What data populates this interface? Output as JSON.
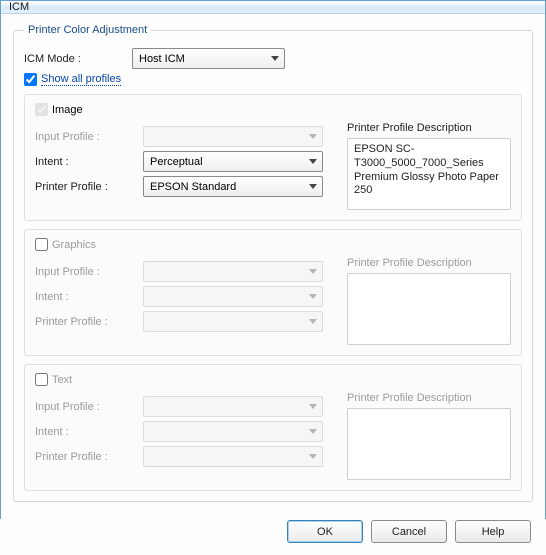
{
  "window": {
    "title": "ICM"
  },
  "groupTitle": "Printer Color Adjustment",
  "icmMode": {
    "label": "ICM Mode :",
    "value": "Host ICM"
  },
  "showAll": {
    "label": "Show all profiles",
    "checked": true
  },
  "labels": {
    "inputProfile": "Input Profile :",
    "intent": "Intent :",
    "printerProfile": "Printer Profile :",
    "descTitle": "Printer Profile Description"
  },
  "image": {
    "title": "Image",
    "checked": true,
    "enabledCheckbox": false,
    "inputProfile": "",
    "intent": "Perceptual",
    "printerProfile": "EPSON Standard",
    "descLine1": "EPSON SC-",
    "descLine2": "T3000_5000_7000_Series",
    "descLine3": "Premium Glossy Photo Paper",
    "descLine4": "250"
  },
  "graphics": {
    "title": "Graphics",
    "checked": false,
    "inputProfile": "",
    "intent": "",
    "printerProfile": "",
    "desc": ""
  },
  "text": {
    "title": "Text",
    "checked": false,
    "inputProfile": "",
    "intent": "",
    "printerProfile": "",
    "desc": ""
  },
  "buttons": {
    "ok": "OK",
    "cancel": "Cancel",
    "help": "Help"
  }
}
